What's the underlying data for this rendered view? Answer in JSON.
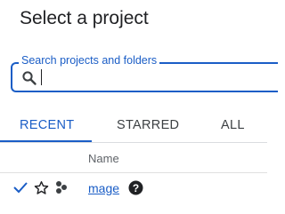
{
  "dialog": {
    "title": "Select a project"
  },
  "search": {
    "label": "Search projects and folders",
    "value": "",
    "icon": "search-icon"
  },
  "tabs": [
    {
      "label": "RECENT",
      "active": true
    },
    {
      "label": "STARRED",
      "active": false
    },
    {
      "label": "ALL",
      "active": false
    }
  ],
  "table": {
    "columns": [
      "Name"
    ],
    "rows": [
      {
        "selected": true,
        "starred": false,
        "type_icon": "project-icon",
        "name": "mage",
        "help_icon": "help-icon"
      }
    ]
  },
  "colors": {
    "accent": "#1a5dc6",
    "text": "#202124",
    "muted": "#5f6368",
    "divider": "#dadce0"
  }
}
